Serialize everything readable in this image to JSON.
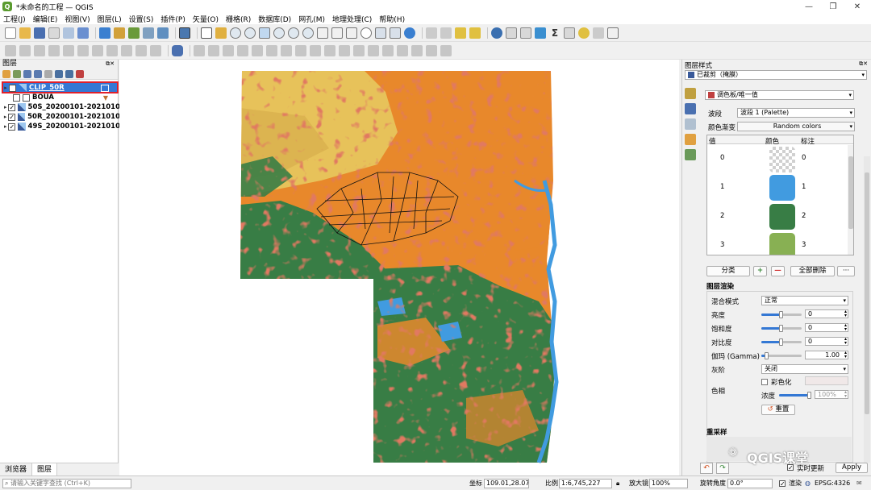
{
  "window": {
    "title": "*未命名的工程 — QGIS"
  },
  "menu": [
    "工程(J)",
    "编辑(E)",
    "视图(V)",
    "图层(L)",
    "设置(S)",
    "插件(P)",
    "矢量(O)",
    "栅格(R)",
    "数据库(D)",
    "网孔(M)",
    "地理处理(C)",
    "帮助(H)"
  ],
  "layers_panel": {
    "title": "图层",
    "items": [
      {
        "name": "CLIP_50R",
        "checked": true,
        "selected": true
      },
      {
        "name": "BOUA",
        "checked": false,
        "selected": false
      },
      {
        "name": "50S_20200101-2021010",
        "checked": true,
        "selected": false
      },
      {
        "name": "50R_20200101-2021010",
        "checked": true,
        "selected": false
      },
      {
        "name": "49S_20200101-2021010",
        "checked": true,
        "selected": false
      }
    ],
    "tabs": [
      "浏览器",
      "图层"
    ]
  },
  "style_panel": {
    "title": "图层样式",
    "layer_combo": "已裁剪（掩膜）",
    "renderer": "调色板/唯一值",
    "band_label": "波段",
    "band_value": "波段 1 (Palette)",
    "ramp_label": "颜色渐变",
    "ramp_value": "Random colors",
    "table_headers": [
      "值",
      "颜色",
      "标注"
    ],
    "rows": [
      {
        "value": "0",
        "color": "transparent",
        "label": "0"
      },
      {
        "value": "1",
        "color": "#419be0",
        "label": "1"
      },
      {
        "value": "2",
        "color": "#387d45",
        "label": "2"
      },
      {
        "value": "3",
        "color": "#88b053",
        "label": "3"
      }
    ],
    "classify_btn": "分类",
    "delete_all_btn": "全部删除",
    "render_section": "图层渲染",
    "blend_label": "混合模式",
    "blend_value": "正常",
    "brightness_label": "亮度",
    "brightness_value": "0",
    "saturation_label": "饱和度",
    "saturation_value": "0",
    "contrast_label": "对比度",
    "contrast_value": "0",
    "gamma_label": "伽玛 (Gamma)",
    "gamma_value": "1.00",
    "grayscale_label": "灰阶",
    "grayscale_value": "关闭",
    "hue_label": "色相",
    "colorize_label": "彩色化",
    "strength_label": "浓度",
    "strength_value": "100%",
    "reset_btn": "重置",
    "resampling_label": "重采样",
    "live_update_label": "实时更新",
    "apply_btn": "Apply"
  },
  "status": {
    "search_placeholder": "请输入关键字查找 (Ctrl+K)",
    "coord_label": "坐标",
    "coord_value": "109.01,28.07",
    "scale_label": "比例",
    "scale_value": "1:6,745,227",
    "magnifier_label": "放大镜",
    "magnifier_value": "100%",
    "rotation_label": "旋转角度",
    "rotation_value": "0.0°",
    "render_label": "渲染",
    "crs": "EPSG:4326"
  },
  "watermark": "QGIS课堂",
  "colors": {
    "water": "#419be0",
    "forest": "#387d45",
    "grass": "#88b053",
    "crop": "#e8882b",
    "bare": "#e7c25a",
    "built": "#c0301f",
    "accent": "#3478d4"
  }
}
